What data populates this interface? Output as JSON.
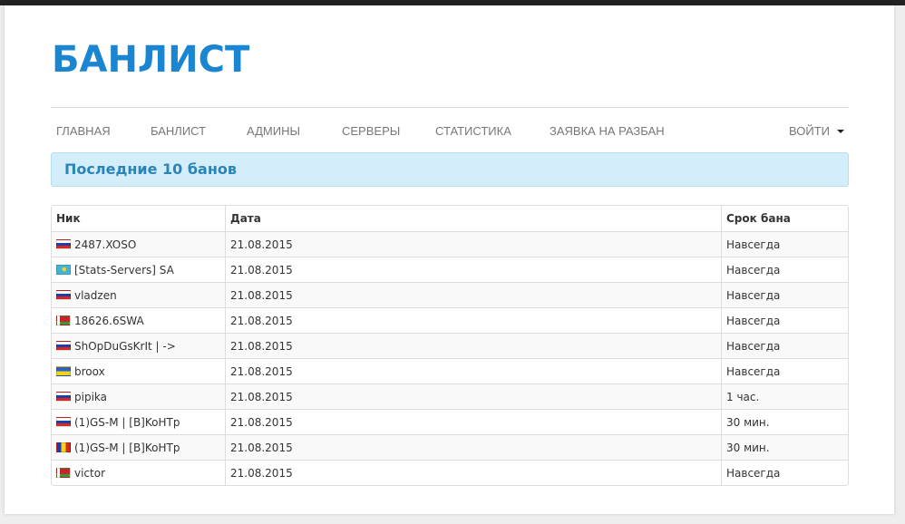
{
  "header": {
    "logo_text": "БАНЛИСТ"
  },
  "nav": {
    "items": [
      "ГЛАВНАЯ",
      "БАНЛИСТ",
      "АДМИНЫ",
      "СЕРВЕРЫ",
      "СТАТИСТИКА",
      "ЗАЯВКА НА РАЗБАН"
    ],
    "login": "ВОЙТИ"
  },
  "alert": {
    "title": "Последние 10 банов"
  },
  "table": {
    "headers": {
      "nick": "Ник",
      "date": "Дата",
      "duration": "Срок бана"
    },
    "rows": [
      {
        "flag": "ru",
        "nick": "2487.XOSO",
        "date": "21.08.2015",
        "duration": "Навсегда"
      },
      {
        "flag": "kz",
        "nick": "[Stats-Servers] SA",
        "date": "21.08.2015",
        "duration": "Навсегда"
      },
      {
        "flag": "ru",
        "nick": "vladzen",
        "date": "21.08.2015",
        "duration": "Навсегда"
      },
      {
        "flag": "by",
        "nick": "18626.6SWA",
        "date": "21.08.2015",
        "duration": "Навсегда"
      },
      {
        "flag": "ru",
        "nick": "ShOpDuGsKrIt | ->",
        "date": "21.08.2015",
        "duration": "Навсегда"
      },
      {
        "flag": "ua",
        "nick": "broox",
        "date": "21.08.2015",
        "duration": "Навсегда"
      },
      {
        "flag": "ru",
        "nick": "pipika",
        "date": "21.08.2015",
        "duration": "1 час."
      },
      {
        "flag": "ru",
        "nick": "(1)GS-M | [B]KoHTp",
        "date": "21.08.2015",
        "duration": "30 мин."
      },
      {
        "flag": "ro",
        "nick": "(1)GS-M | [B]KoHTp",
        "date": "21.08.2015",
        "duration": "30 мин."
      },
      {
        "flag": "by",
        "nick": "victor",
        "date": "21.08.2015",
        "duration": "Навсегда"
      }
    ]
  }
}
